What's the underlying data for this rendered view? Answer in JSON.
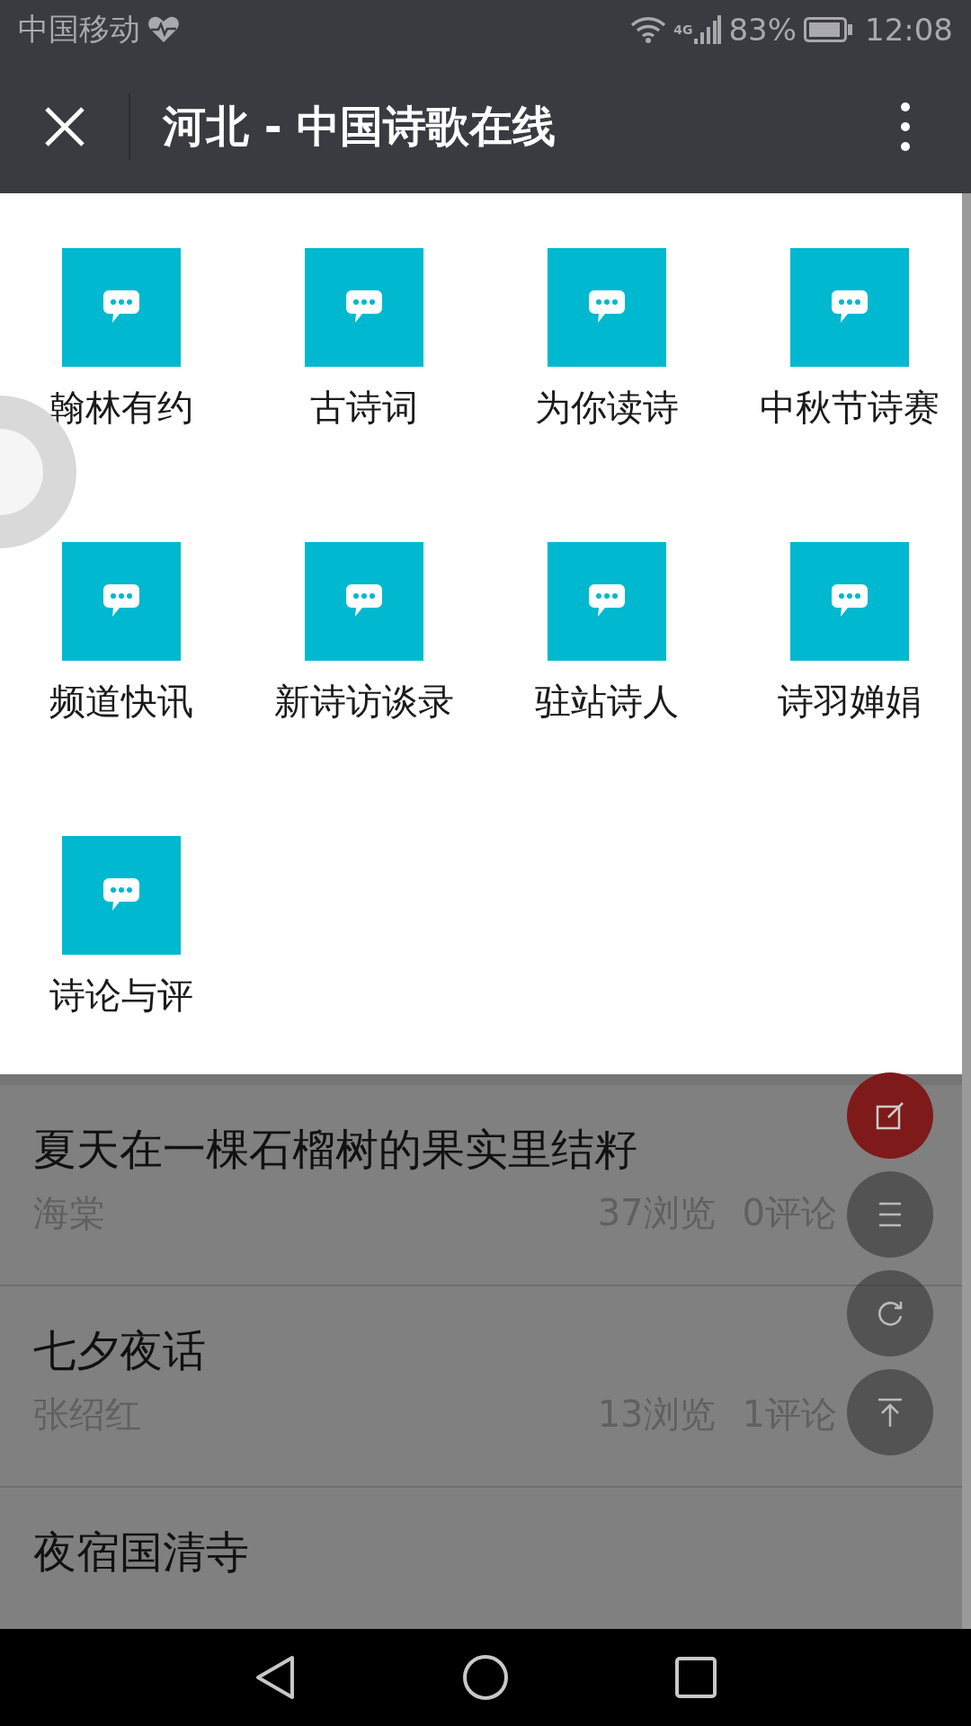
{
  "status_bar": {
    "carrier": "中国移动",
    "network": "4G",
    "battery": "83%",
    "time": "12:08"
  },
  "header": {
    "title": "河北 - 中国诗歌在线"
  },
  "menu_grid": [
    {
      "label": "翰林有约"
    },
    {
      "label": "古诗词"
    },
    {
      "label": "为你读诗"
    },
    {
      "label": "中秋节诗赛"
    },
    {
      "label": "频道快讯"
    },
    {
      "label": "新诗访谈录"
    },
    {
      "label": "驻站诗人"
    },
    {
      "label": "诗羽婵娟"
    },
    {
      "label": "诗论与评"
    }
  ],
  "articles": [
    {
      "title": "夏天在一棵石榴树的果实里结籽",
      "author": "海棠",
      "views": "37浏览",
      "comments": "0评论"
    },
    {
      "title": "七夕夜话",
      "author": "张绍红",
      "views": "13浏览",
      "comments": "1评论"
    },
    {
      "title": "夜宿国清寺"
    }
  ],
  "fabs": [
    {
      "kind": "edit"
    },
    {
      "kind": "menu"
    },
    {
      "kind": "refresh"
    },
    {
      "kind": "top"
    }
  ]
}
